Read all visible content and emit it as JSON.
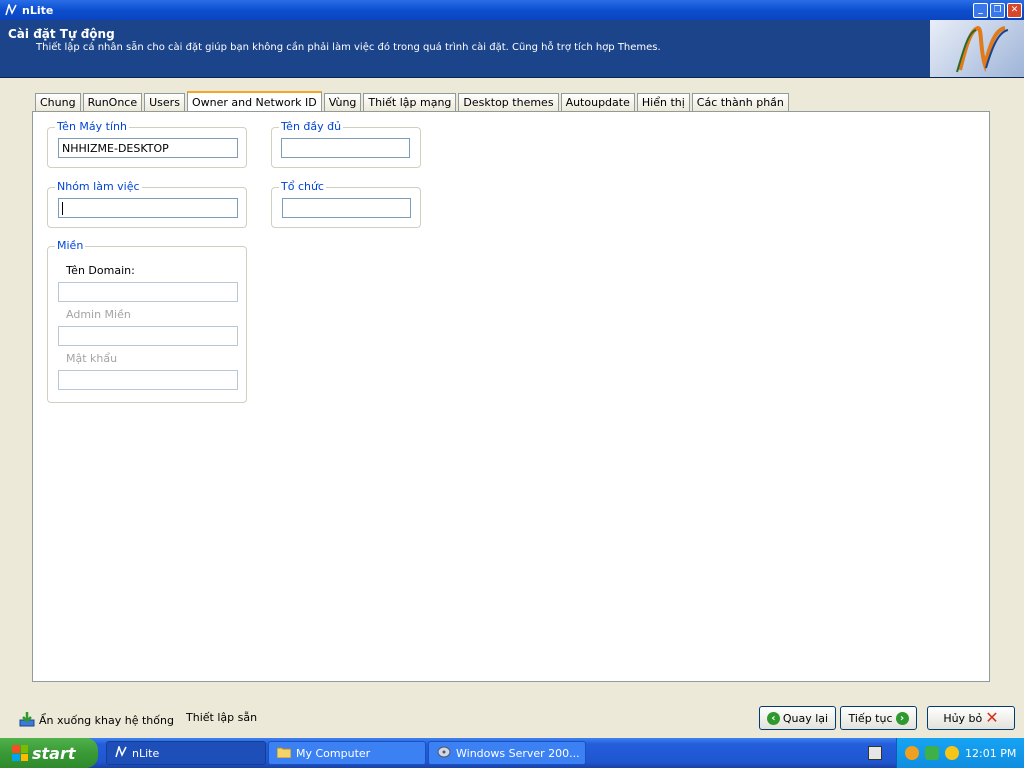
{
  "window": {
    "title": "nLite"
  },
  "header": {
    "title": "Cài đặt Tự động",
    "description": "Thiết lập cá nhân sẵn cho cài đặt giúp bạn không cần phải làm việc đó trong quá trình cài đặt. Cũng hỗ trợ tích hợp Themes."
  },
  "tabs": [
    {
      "label": "Chung"
    },
    {
      "label": "RunOnce"
    },
    {
      "label": "Users"
    },
    {
      "label": "Owner and Network ID"
    },
    {
      "label": "Vùng"
    },
    {
      "label": "Thiết lập mạng"
    },
    {
      "label": "Desktop themes"
    },
    {
      "label": "Autoupdate"
    },
    {
      "label": "Hiển thị"
    },
    {
      "label": "Các thành phần"
    }
  ],
  "active_tab": "Owner and Network ID",
  "form": {
    "computer_name": {
      "legend": "Tên Máy tính",
      "value": "NHHIZME-DESKTOP"
    },
    "full_name": {
      "legend": "Tên đầy đủ",
      "value": ""
    },
    "workgroup": {
      "legend": "Nhóm làm việc",
      "value": ""
    },
    "organization": {
      "legend": "Tổ chức",
      "value": ""
    },
    "domain": {
      "legend": "Miền",
      "domain_name_label": "Tên Domain:",
      "domain_name_value": "",
      "admin_label": "Admin Miền",
      "admin_value": "",
      "password_label": "Mật khẩu",
      "password_value": ""
    }
  },
  "bottom": {
    "minimize_tray": "Ẩn xuống khay hệ thống",
    "presets": "Thiết lập sẵn",
    "back": "Quay lại",
    "next": "Tiếp tục",
    "cancel": "Hủy bỏ"
  },
  "taskbar": {
    "start": "start",
    "tasks": [
      {
        "label": "nLite"
      },
      {
        "label": "My Computer"
      },
      {
        "label": "Windows Server 200..."
      }
    ],
    "clock": "12:01 PM"
  }
}
